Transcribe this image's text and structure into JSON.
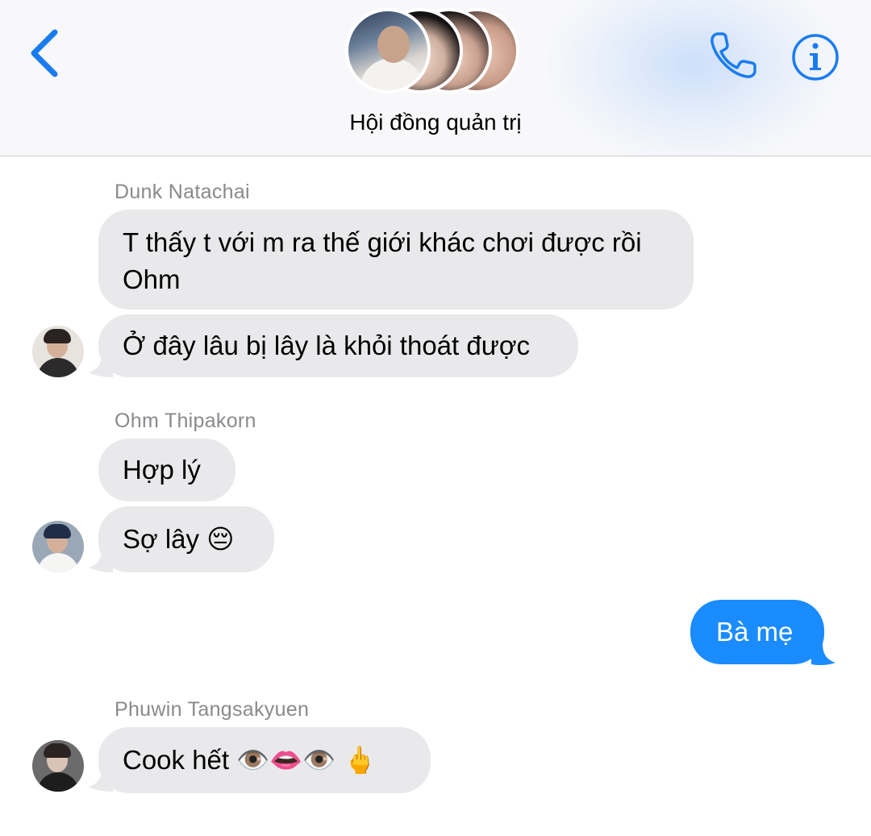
{
  "header": {
    "title": "Hội đồng quản trị",
    "back_icon": "chevron-left-icon",
    "call_icon": "phone-icon",
    "info_icon": "info-icon",
    "accent_color": "#1a7cf0"
  },
  "messages": [
    {
      "sender": "Dunk Natachai",
      "bubbles": [
        "T thấy t với m ra thế giới khác chơi được rồi\nOhm",
        "Ở đây lâu bị lây là khỏi thoát được"
      ]
    },
    {
      "sender": "Ohm Thipakorn",
      "bubbles": [
        "Hợp lý",
        "Sợ lây 😔"
      ]
    },
    {
      "sender": "me",
      "bubbles": [
        "Bà mẹ"
      ]
    },
    {
      "sender": "Phuwin Tangsakyuen",
      "bubbles": [
        "Cook hết 👁️👄👁️ 🖕"
      ]
    }
  ],
  "colors": {
    "incoming_bubble": "#e9e9eb",
    "outgoing_bubble": "#1a8cff",
    "sender_name": "#8a8a8e"
  }
}
